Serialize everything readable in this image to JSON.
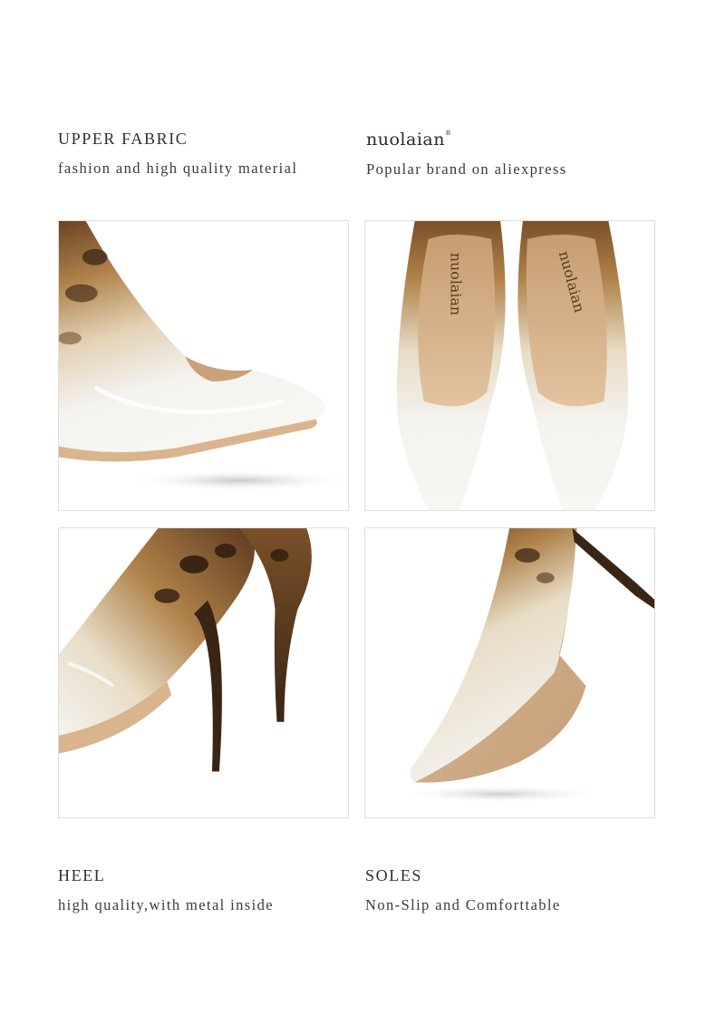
{
  "features": {
    "upper_fabric": {
      "title": "UPPER FABRIC",
      "subtitle": "fashion and high quality material"
    },
    "brand": {
      "logo": "nuolaian",
      "trademark": "®",
      "subtitle": "Popular brand on aliexpress"
    },
    "heel": {
      "title": "HEEL",
      "subtitle": "high quality,with metal inside"
    },
    "soles": {
      "title": "SOLES",
      "subtitle": "Non-Slip and Comforttable"
    }
  },
  "insole_print": "nuolaian",
  "colors": {
    "patent_white": "#f4f3ef",
    "leopard_base": "#b0824a",
    "leopard_spot": "#3a2514",
    "nude_lining": "#d9b48d",
    "border": "#dedede"
  }
}
